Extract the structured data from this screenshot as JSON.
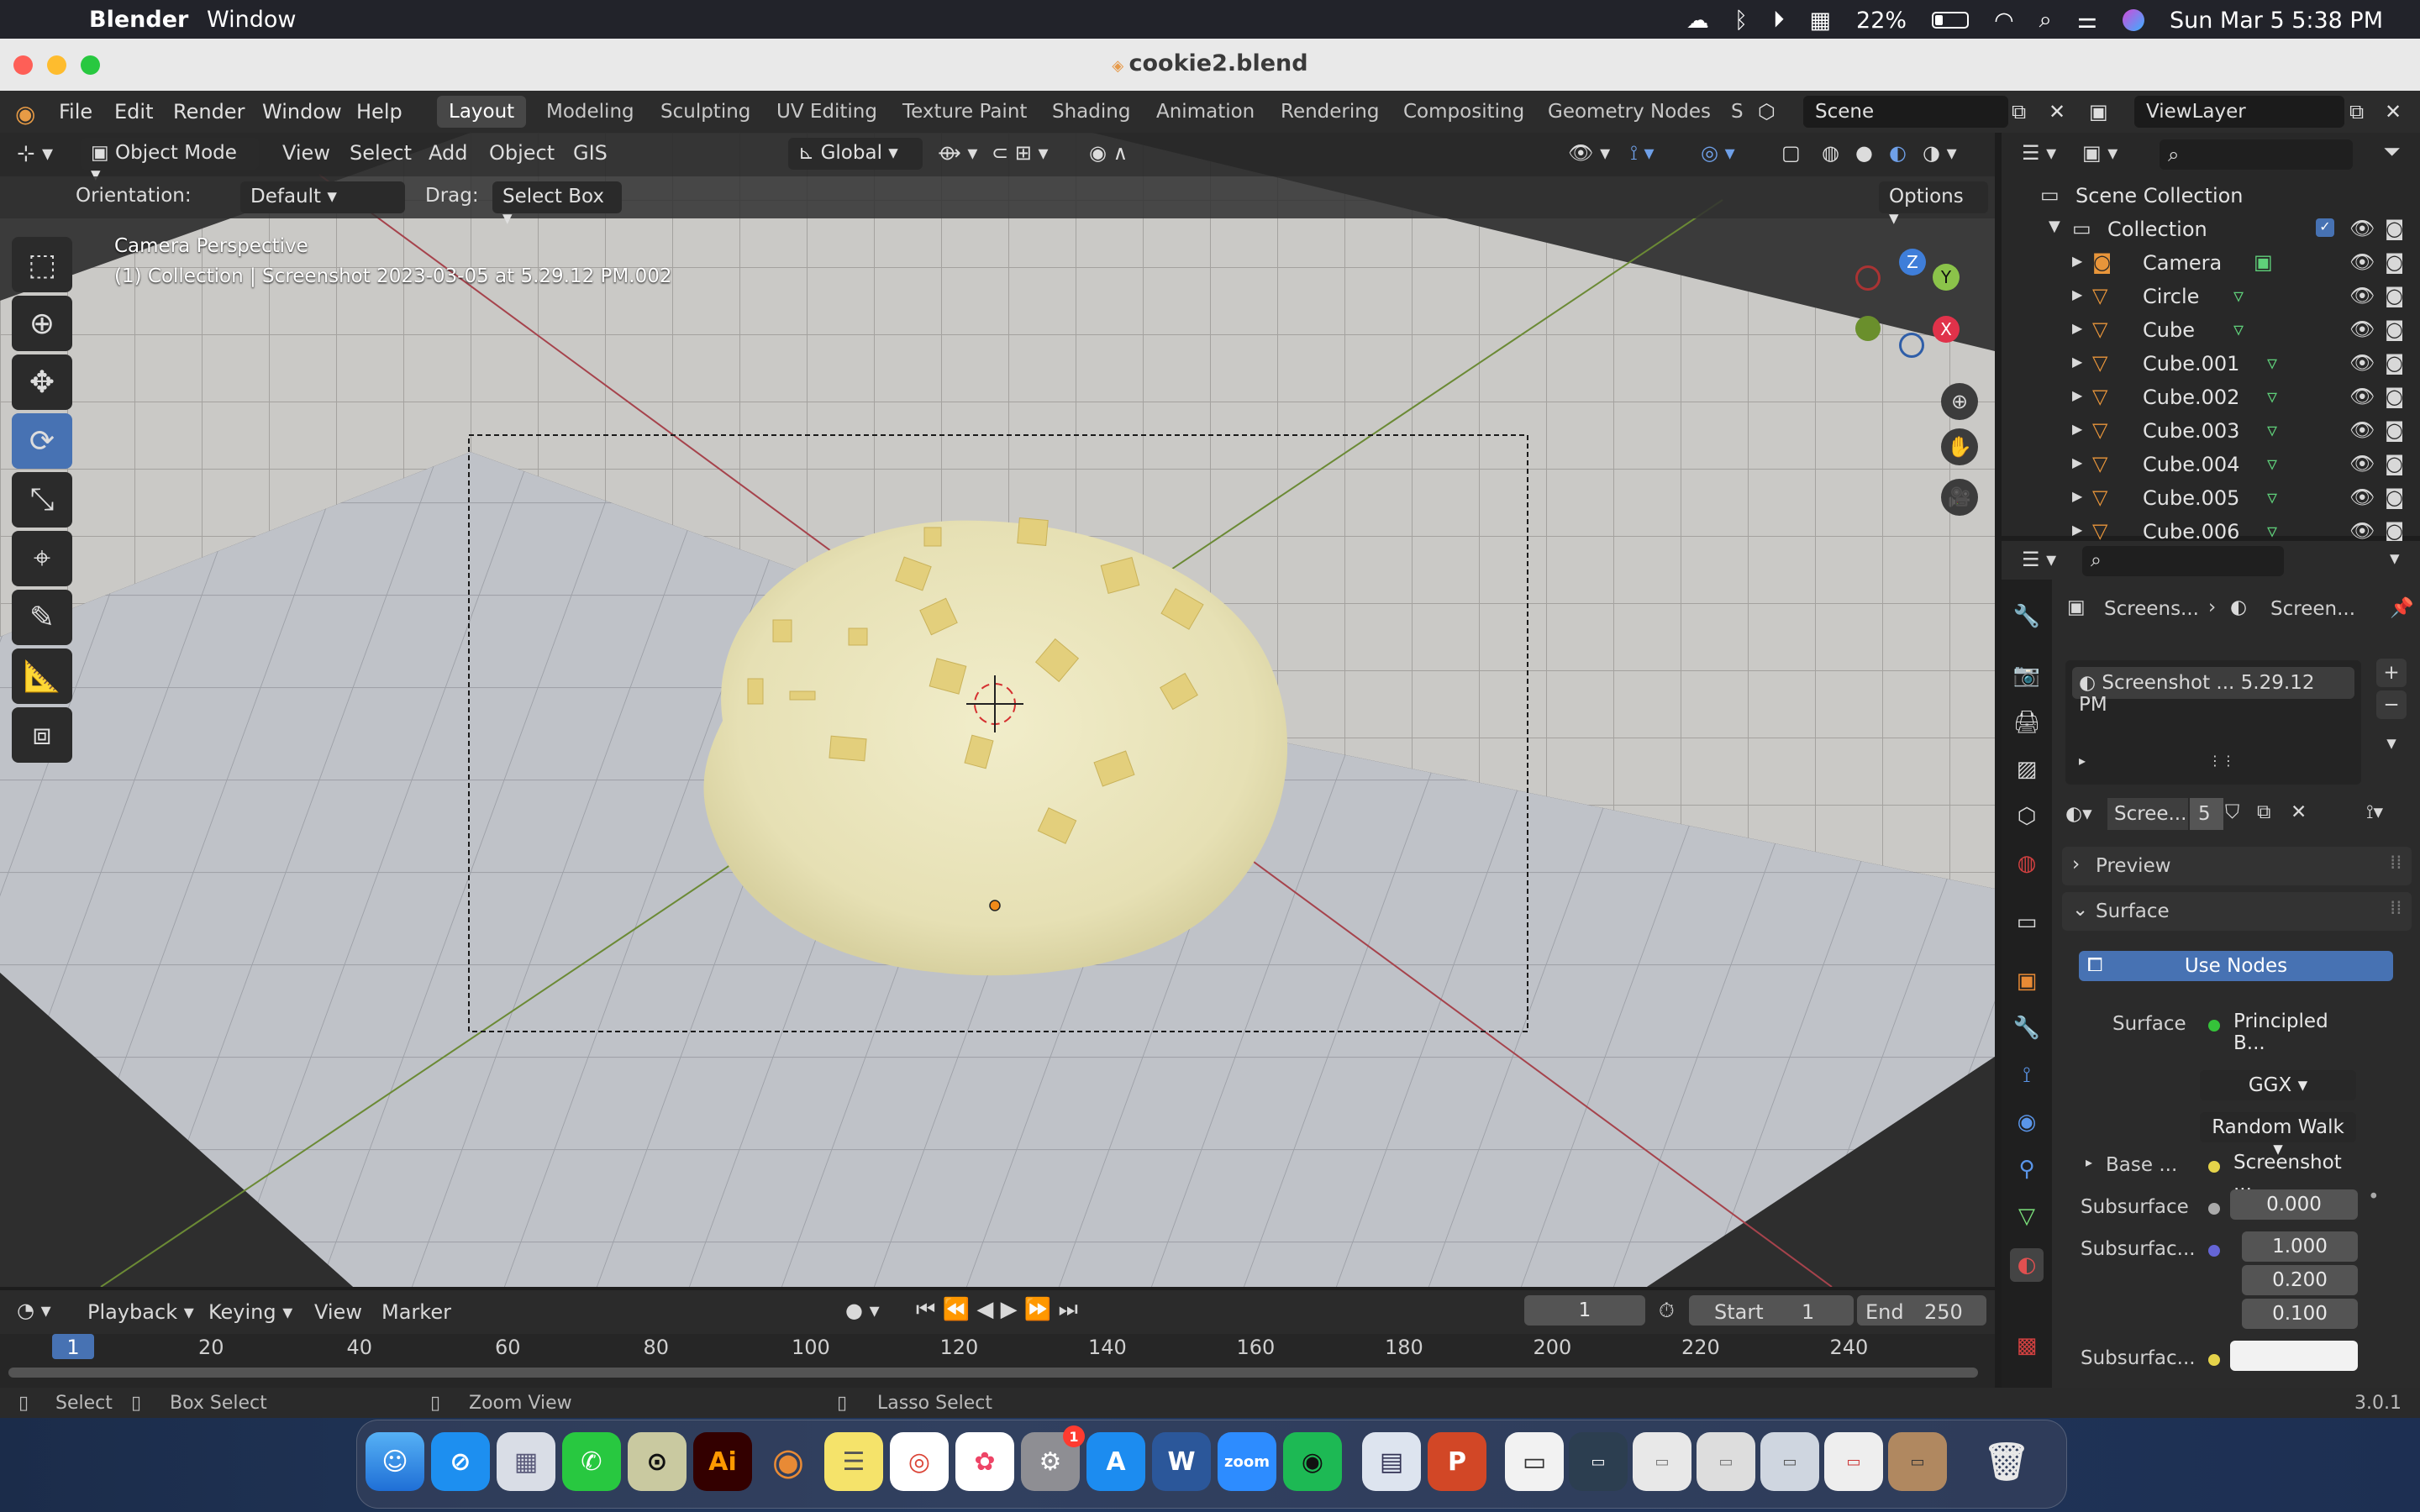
{
  "menubar": {
    "app_name": "Blender",
    "menu_window": "Window",
    "battery": "22%",
    "datetime": "Sun Mar 5  5:38 PM"
  },
  "window": {
    "title": "cookie2.blend"
  },
  "topbar": {
    "menus": [
      "File",
      "Edit",
      "Render",
      "Window",
      "Help"
    ],
    "workspaces": [
      "Layout",
      "Modeling",
      "Sculpting",
      "UV Editing",
      "Texture Paint",
      "Shading",
      "Animation",
      "Rendering",
      "Compositing",
      "Geometry Nodes",
      "S"
    ],
    "scene": "Scene",
    "view_layer": "ViewLayer"
  },
  "viewport": {
    "mode": "Object Mode",
    "menus": [
      "View",
      "Select",
      "Add",
      "Object",
      "GIS"
    ],
    "transform_orientation": "Global",
    "orientation_label": "Orientation:",
    "orientation_value": "Default",
    "drag_label": "Drag:",
    "drag_value": "Select Box",
    "options": "Options",
    "overlay_title": "Camera Perspective",
    "overlay_subtitle": "(1) Collection | Screenshot 2023-03-05 at 5.29.12 PM.002",
    "gizmo": {
      "x": "X",
      "y": "Y",
      "z": "Z"
    }
  },
  "outliner": {
    "root": "Scene Collection",
    "collection": "Collection",
    "items": [
      "Camera",
      "Circle",
      "Cube",
      "Cube.001",
      "Cube.002",
      "Cube.003",
      "Cube.004",
      "Cube.005",
      "Cube.006"
    ]
  },
  "properties": {
    "breadcrumb_1": "Screens...",
    "breadcrumb_2": "Screen...",
    "slot_name": "Screenshot ... 5.29.12 PM",
    "material_name": "Scree...",
    "user_count": "5",
    "section_preview": "Preview",
    "section_surface": "Surface",
    "use_nodes": "Use Nodes",
    "surface_label": "Surface",
    "surface_value": "Principled B...",
    "distribution": "GGX",
    "subsurface_method": "Random Walk",
    "base_label": "Base ...",
    "base_value": "Screenshot ...",
    "subsurface_label": "Subsurface",
    "subsurface_value": "0.000",
    "subsurface_radius_label": "Subsurfac...",
    "radius_values": [
      "1.000",
      "0.200",
      "0.100"
    ],
    "subsurface_color_label": "Subsurfac..."
  },
  "timeline": {
    "menus": [
      "Playback",
      "Keying",
      "View",
      "Marker"
    ],
    "current_frame": "1",
    "start_label": "Start",
    "start_value": "1",
    "end_label": "End",
    "end_value": "250",
    "ruler": [
      "1",
      "20",
      "40",
      "60",
      "80",
      "100",
      "120",
      "140",
      "160",
      "180",
      "200",
      "220",
      "240"
    ]
  },
  "statusbar": {
    "select": "Select",
    "box_select": "Box Select",
    "zoom_view": "Zoom View",
    "lasso_select": "Lasso Select",
    "version": "3.0.1"
  },
  "dock": {
    "apps": [
      "Finder",
      "Safari",
      "Launchpad",
      "WhatsApp",
      "Screenshot",
      "Illustrator",
      "Blender",
      "Notes",
      "Chrome",
      "Photos",
      "System Preferences",
      "App Store",
      "Word",
      "Zoom",
      "Spotify",
      "Preview",
      "PowerPoint"
    ],
    "badge": "1",
    "label_ai": "Ai",
    "label_zoom": "zoom",
    "label_word": "W",
    "label_ppt": "P"
  },
  "colors": {
    "accent": "#4772b3",
    "x_axis": "#e0324a",
    "y_axis": "#8bc34a",
    "z_axis": "#3f7ed9"
  }
}
